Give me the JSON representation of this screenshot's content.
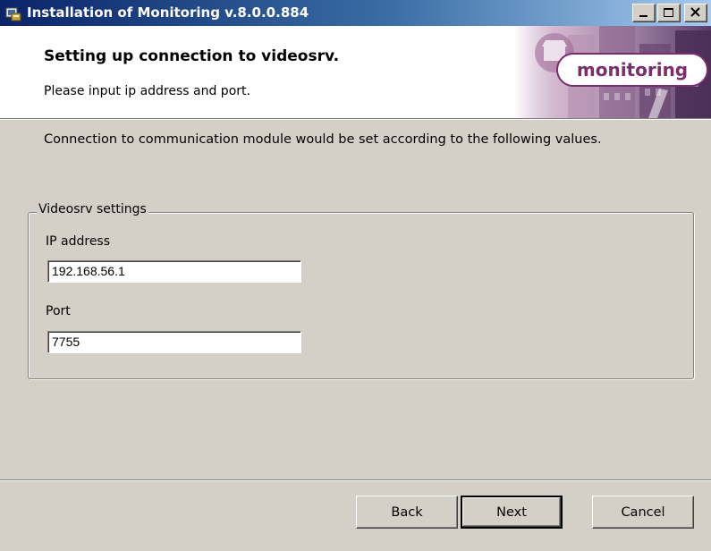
{
  "window": {
    "title": "Installation of Monitoring v.8.0.0.884",
    "icon": "installer-icon",
    "controls": [
      "minimize-icon",
      "maximize-icon",
      "close-icon"
    ]
  },
  "banner": {
    "title": "Setting up connection to videosrv.",
    "subtitle": "Please input ip address and port.",
    "logo_text": "monitoring",
    "logo_color": "#7a2d6e"
  },
  "content": {
    "intro": "Connection to communication module would be set according to the following values.",
    "group": {
      "legend": "Videosrv settings",
      "ip_label": "IP address",
      "ip_value": "192.168.56.1",
      "port_label": "Port",
      "port_value": "7755"
    }
  },
  "buttons": {
    "back": "Back",
    "next": "Next",
    "cancel": "Cancel"
  },
  "colors": {
    "titlebar_start": "#0a246a",
    "titlebar_end": "#a6caf0",
    "face": "#d4d0c8",
    "banner_bg": "#ffffff"
  }
}
